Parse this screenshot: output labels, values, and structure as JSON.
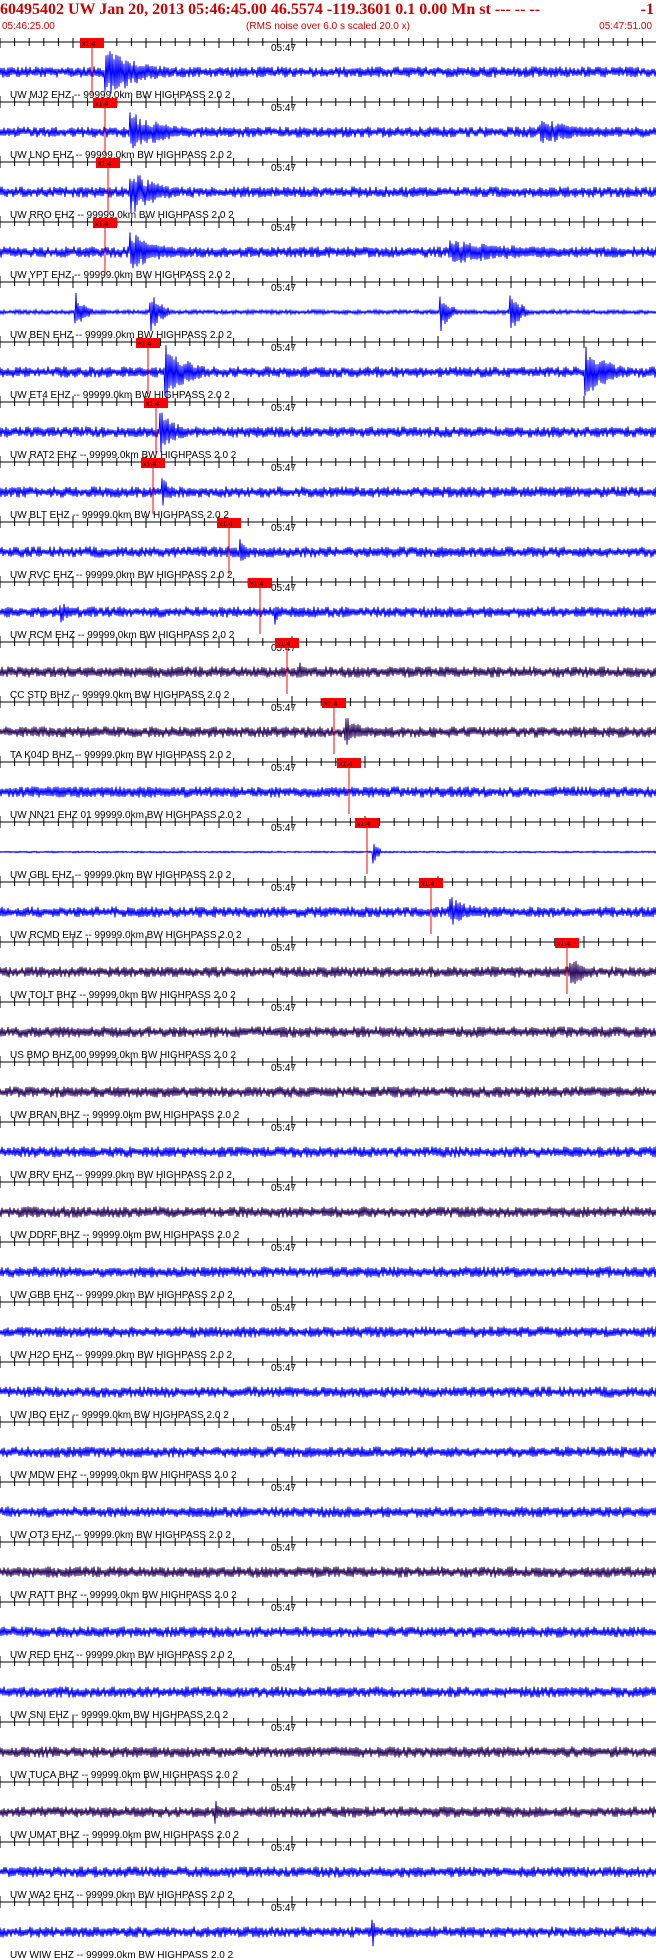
{
  "header": {
    "title": "60495402 UW Jan 20, 2013 05:46:45.00   46.5574 -119.3601  0.1 0.00 Mn st --- -- --",
    "title_right": "-1",
    "start_time": "05:46:25.00",
    "subtitle": "(RMS noise over 6.0 s scaled 20.0 x)",
    "end_time": "05:47:51.00"
  },
  "chart_data": {
    "type": "line",
    "title": "60495402 UW Jan 20, 2013 05:46:45.00   46.5574 -119.3601  0.1 0.00 Mn st --- -- --",
    "x_range": [
      "05:46:25.00",
      "05:47:51.00"
    ],
    "minute_label": "05:47",
    "pick_label": "x1.4",
    "colors": {
      "blue": "#0000ff",
      "navy": "#2a0a5e",
      "pick": "#ff0000",
      "header": "#cc0000"
    },
    "traces": [
      {
        "label": "UW MJ2 EHZ -- 99999.0km BW  HIGHPASS  2.0  2",
        "color": "blue"
      },
      {
        "label": "UW LNO EHZ -- 99999.0km BW  HIGHPASS  2.0  2",
        "color": "blue"
      },
      {
        "label": "UW RRO EHZ -- 99999.0km BW  HIGHPASS  2.0  2",
        "color": "blue"
      },
      {
        "label": "UW YPT EHZ -- 99999.0km BW  HIGHPASS  2.0  2",
        "color": "blue"
      },
      {
        "label": "UW BEN EHZ -- 99999.0km BW  HIGHPASS  2.0  2",
        "color": "blue"
      },
      {
        "label": "UW ET4 EHZ -- 99999.0km BW  HIGHPASS  2.0  2",
        "color": "blue"
      },
      {
        "label": "UW RAT2 EHZ -- 99999.0km BW  HIGHPASS  2.0  2",
        "color": "blue"
      },
      {
        "label": "UW BLT EHZ -- 99999.0km BW  HIGHPASS  2.0  2",
        "color": "blue"
      },
      {
        "label": "UW RVC EHZ -- 99999.0km BW  HIGHPASS  2.0  2",
        "color": "blue"
      },
      {
        "label": "UW RCM EHZ -- 99999.0km BW  HIGHPASS  2.0  2",
        "color": "blue"
      },
      {
        "label": "CC STD BHZ -- 99999.0km BW  HIGHPASS  2.0  2",
        "color": "navy"
      },
      {
        "label": "TA K04D BHZ -- 99999.0km BW  HIGHPASS  2.0  2",
        "color": "navy"
      },
      {
        "label": "UW NN21 EHZ 01 99999.0km BW  HIGHPASS  2.0  2",
        "color": "blue"
      },
      {
        "label": "UW GBL EHZ -- 99999.0km BW  HIGHPASS  2.0  2",
        "color": "blue"
      },
      {
        "label": "UW RCMD EHZ -- 99999.0km BW  HIGHPASS  2.0  2",
        "color": "blue"
      },
      {
        "label": "UW TOLT BHZ -- 99999.0km BW  HIGHPASS  2.0  2",
        "color": "navy"
      },
      {
        "label": "US BMO BHZ 00 99999.0km BW  HIGHPASS  2.0  2",
        "color": "navy"
      },
      {
        "label": "UW BRAN BHZ -- 99999.0km BW  HIGHPASS  2.0  2",
        "color": "navy"
      },
      {
        "label": "UW BRV EHZ -- 99999.0km BW  HIGHPASS  2.0  2",
        "color": "blue"
      },
      {
        "label": "UW DDRF BHZ -- 99999.0km BW  HIGHPASS  2.0  2",
        "color": "navy"
      },
      {
        "label": "UW GBB EHZ -- 99999.0km BW  HIGHPASS  2.0  2",
        "color": "blue"
      },
      {
        "label": "UW H2O EHZ -- 99999.0km BW  HIGHPASS  2.0  2",
        "color": "blue"
      },
      {
        "label": "UW IBO EHZ -- 99999.0km BW  HIGHPASS  2.0  2",
        "color": "blue"
      },
      {
        "label": "UW MDW EHZ -- 99999.0km BW  HIGHPASS  2.0  2",
        "color": "blue"
      },
      {
        "label": "UW OT3 EHZ -- 99999.0km BW  HIGHPASS  2.0  2",
        "color": "blue"
      },
      {
        "label": "UW RATT BHZ -- 99999.0km BW  HIGHPASS  2.0  2",
        "color": "navy"
      },
      {
        "label": "UW RED EHZ -- 99999.0km BW  HIGHPASS  2.0  2",
        "color": "blue"
      },
      {
        "label": "UW SNI EHZ -- 99999.0km BW  HIGHPASS  2.0  2",
        "color": "blue"
      },
      {
        "label": "UW TUCA BHZ -- 99999.0km BW  HIGHPASS  2.0  2",
        "color": "navy"
      },
      {
        "label": "UW UMAT BHZ -- 99999.0km BW  HIGHPASS  2.0  2",
        "color": "navy"
      },
      {
        "label": "UW WA2 EHZ -- 99999.0km BW  HIGHPASS  2.0  2",
        "color": "blue"
      },
      {
        "label": "UW WIW EHZ -- 99999.0km BW  HIGHPASS  2.0  2",
        "color": "blue"
      }
    ]
  }
}
